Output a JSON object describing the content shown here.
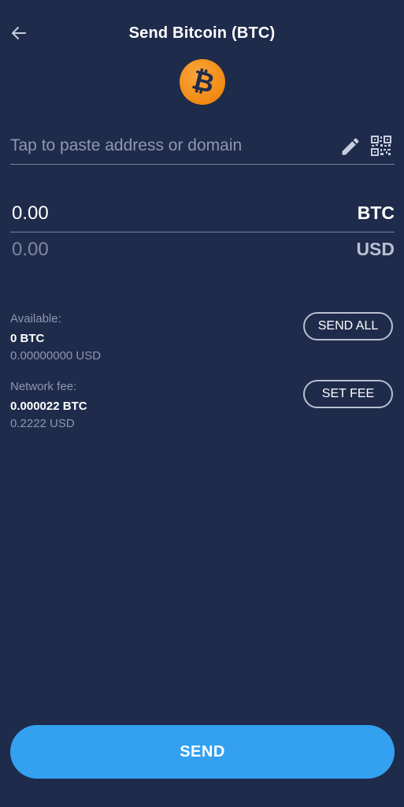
{
  "header": {
    "title": "Send Bitcoin (BTC)",
    "back_icon": "arrow-left-icon",
    "coin_icon": "bitcoin-icon",
    "coin_symbol": "₿",
    "coin_color": "#f7931a"
  },
  "address": {
    "placeholder": "Tap to paste address or domain",
    "value": "",
    "edit_icon": "pencil-icon",
    "scan_icon": "qr-code-icon"
  },
  "amount": {
    "crypto_value": "0.00",
    "crypto_unit": "BTC",
    "fiat_value": "0.00",
    "fiat_unit": "USD"
  },
  "available": {
    "label": "Available:",
    "crypto": "0 BTC",
    "fiat": "0.00000000 USD",
    "button": "SEND ALL"
  },
  "fee": {
    "label": "Network fee:",
    "crypto": "0.000022 BTC",
    "fiat": "0.2222 USD",
    "button": "SET FEE"
  },
  "send_button": "SEND",
  "colors": {
    "background": "#1f2b4b",
    "accent": "#33a1f0"
  }
}
